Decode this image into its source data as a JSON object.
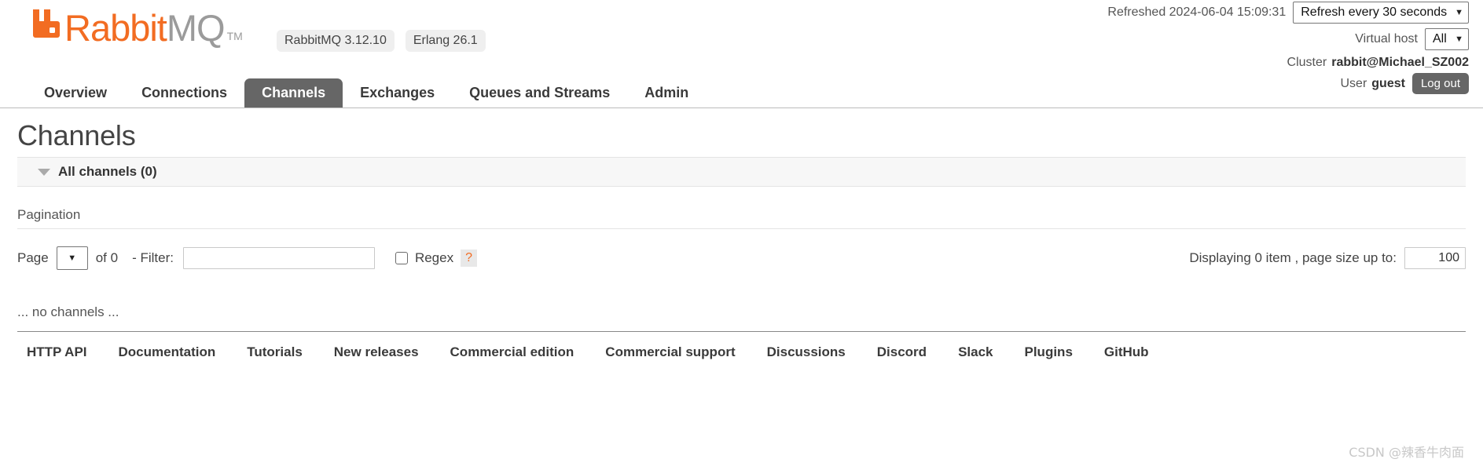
{
  "brand": {
    "name_part1": "Rabbit",
    "name_part2": "MQ",
    "trademark": "TM",
    "logo_icon": "rabbitmq-logo-icon",
    "accent_color": "#f26c22",
    "gray_color": "#9b9b9b"
  },
  "badges": [
    {
      "label": "RabbitMQ 3.12.10"
    },
    {
      "label": "Erlang 26.1"
    }
  ],
  "header": {
    "refreshed_label": "Refreshed 2024-06-04 15:09:31",
    "refresh_select_value": "Refresh every 30 seconds",
    "vhost_label": "Virtual host",
    "vhost_select_value": "All",
    "cluster_label": "Cluster",
    "cluster_value": "rabbit@Michael_SZ002",
    "user_label": "User",
    "user_value": "guest",
    "logout_label": "Log out",
    "caret_icon": "chevron-down-icon"
  },
  "nav": {
    "tabs": [
      {
        "label": "Overview",
        "active": false
      },
      {
        "label": "Connections",
        "active": false
      },
      {
        "label": "Channels",
        "active": true
      },
      {
        "label": "Exchanges",
        "active": false
      },
      {
        "label": "Queues and Streams",
        "active": false
      },
      {
        "label": "Admin",
        "active": false
      }
    ]
  },
  "main": {
    "page_title": "Channels",
    "section": {
      "toggle_icon": "triangle-down-icon",
      "label": "All channels (0)"
    },
    "pagination_heading": "Pagination",
    "pagination": {
      "page_label": "Page",
      "page_select_value": "",
      "of_label": "of 0",
      "filter_label": "- Filter:",
      "filter_value": "",
      "filter_placeholder": "",
      "regex_label": "Regex",
      "regex_checked": false,
      "help_label": "?",
      "displaying_label": "Displaying 0 item , page size up to:",
      "page_size_value": "100"
    },
    "empty_message": "... no channels ..."
  },
  "footer": {
    "links": [
      {
        "label": "HTTP API"
      },
      {
        "label": "Documentation"
      },
      {
        "label": "Tutorials"
      },
      {
        "label": "New releases"
      },
      {
        "label": "Commercial edition"
      },
      {
        "label": "Commercial support"
      },
      {
        "label": "Discussions"
      },
      {
        "label": "Discord"
      },
      {
        "label": "Slack"
      },
      {
        "label": "Plugins"
      },
      {
        "label": "GitHub"
      }
    ]
  },
  "watermark": {
    "text": "CSDN @辣香牛肉面"
  }
}
